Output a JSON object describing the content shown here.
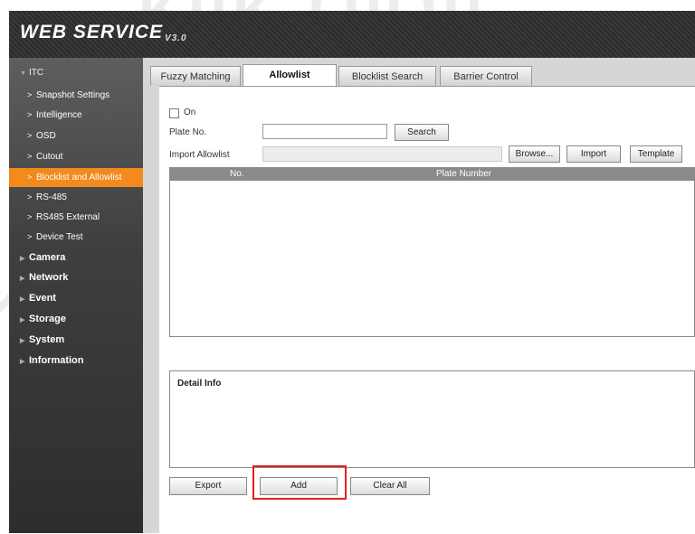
{
  "header": {
    "logo_text": "WEB  SERVICE",
    "version": "V3.0"
  },
  "sidebar": {
    "section_itc": "ITC",
    "itc_items": [
      {
        "label": "Snapshot Settings"
      },
      {
        "label": "Intelligence"
      },
      {
        "label": "OSD"
      },
      {
        "label": "Cutout"
      },
      {
        "label": "Blocklist and Allowlist",
        "active": true
      },
      {
        "label": "RS-485"
      },
      {
        "label": "RS485 External"
      },
      {
        "label": "Device Test"
      }
    ],
    "main_items": [
      "Camera",
      "Network",
      "Event",
      "Storage",
      "System",
      "Information"
    ]
  },
  "tabs": [
    {
      "label": "Fuzzy Matching"
    },
    {
      "label": "Allowlist",
      "active": true
    },
    {
      "label": "Blocklist Search"
    },
    {
      "label": "Barrier Control"
    }
  ],
  "form": {
    "on_label": "On",
    "on_checked": false,
    "plate_no_label": "Plate No.",
    "plate_no_value": "",
    "search_button": "Search",
    "import_label": "Import Allowlist",
    "import_value": "",
    "browse_button": "Browse...",
    "import_button": "Import",
    "template_button": "Template"
  },
  "table": {
    "col_no": "No.",
    "col_plate": "Plate Number",
    "rows": []
  },
  "detail": {
    "title": "Detail Info"
  },
  "actions": {
    "export": "Export",
    "add": "Add",
    "clear_all": "Clear All"
  },
  "colors": {
    "active_nav": "#f28a1e",
    "highlight_box": "#e51f1f"
  }
}
